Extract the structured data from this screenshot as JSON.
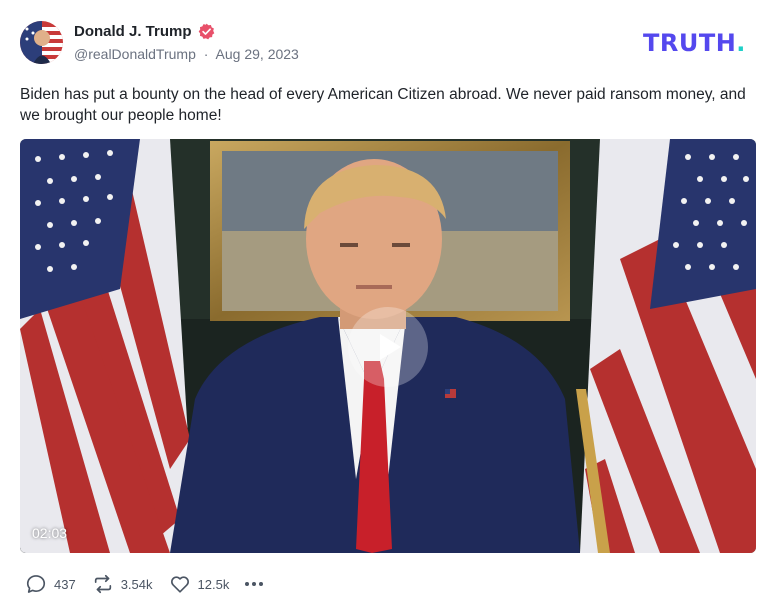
{
  "author": {
    "display_name": "Donald J. Trump",
    "handle": "@realDonaldTrump",
    "date": "Aug 29, 2023",
    "separator": "·"
  },
  "brand": {
    "logo_text": "TRUTH",
    "logo_dot": ".",
    "logo_color": "#5448ee",
    "dot_color": "#1fd0c8"
  },
  "post": {
    "text": "Biden has put a bounty on the head of every American Citizen abroad. We never paid ransom money, and we brought our people home!"
  },
  "video": {
    "duration": "02:03"
  },
  "actions": {
    "replies": "437",
    "retruths": "3.54k",
    "likes": "12.5k"
  },
  "icons": {
    "verified": "verified-badge-icon",
    "reply": "comment-bubble-icon",
    "retruth": "repost-arrows-icon",
    "like": "heart-icon",
    "more": "more-dots-icon",
    "play": "play-icon"
  }
}
